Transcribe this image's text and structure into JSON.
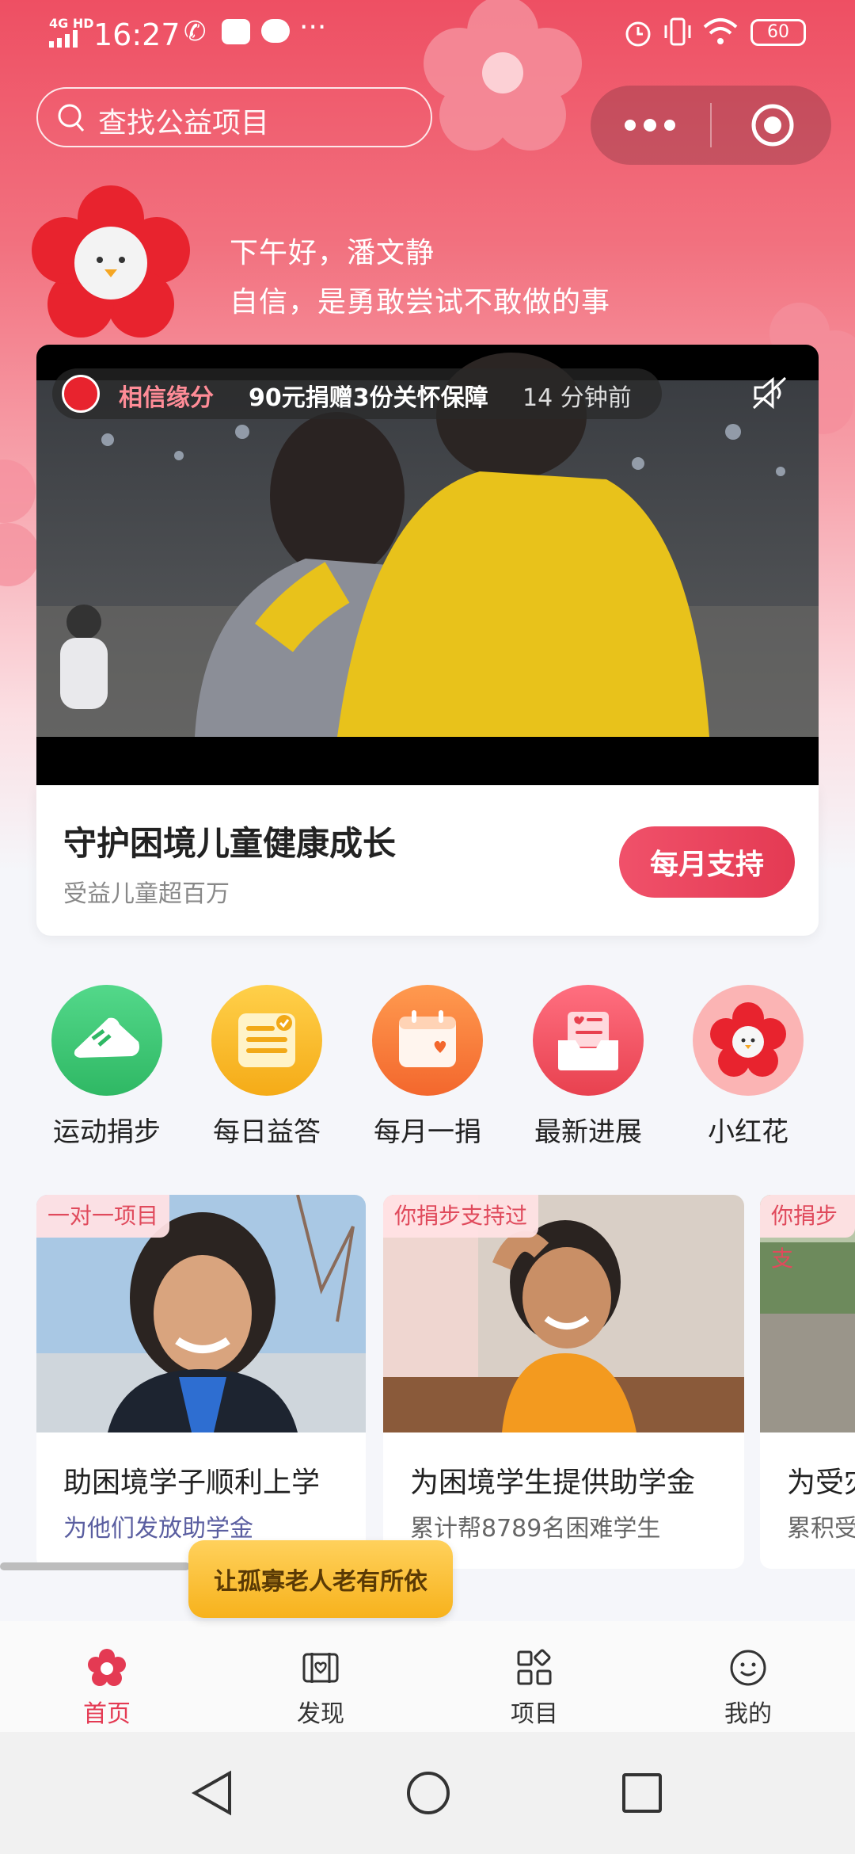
{
  "status_bar": {
    "network": "4G HD",
    "time": "16:27",
    "battery": "60"
  },
  "search": {
    "placeholder": "查找公益项目"
  },
  "greeting": {
    "line1": "下午好，潘文静",
    "line2": "自信，是勇敢尝试不敢做的事"
  },
  "banner": {
    "ticker_name": "相信缘分",
    "ticker_action": "90元捐赠3份关怀保障",
    "ticker_time": "14 分钟前",
    "title": "守护困境儿童健康成长",
    "subtitle": "受益儿童超百万",
    "button": "每月支持"
  },
  "shortcuts": [
    {
      "label": "运动捐步",
      "icon": "sneaker-icon",
      "color": "#3cc474"
    },
    {
      "label": "每日益答",
      "icon": "quiz-list-icon",
      "color": "#f7b422"
    },
    {
      "label": "每月一捐",
      "icon": "calendar-heart-icon",
      "color": "#f77a3a"
    },
    {
      "label": "最新进展",
      "icon": "inbox-update-icon",
      "color": "#ef5566"
    },
    {
      "label": "小红花",
      "icon": "red-flower-icon",
      "color": "#f9a5a5"
    }
  ],
  "projects": [
    {
      "tag": "一对一项目",
      "title": "助困境学子顺利上学",
      "subtitle": "为他们发放助学金"
    },
    {
      "tag": "你捐步支持过",
      "title": "为困境学生提供助学金",
      "subtitle": "累计帮8789名困难学生"
    },
    {
      "tag": "你捐步支",
      "title": "为受灾",
      "subtitle": "累积受"
    }
  ],
  "tooltip": "让孤寡老人老有所依",
  "tabs": [
    {
      "label": "首页",
      "icon": "flower-home-icon",
      "active": true
    },
    {
      "label": "发现",
      "icon": "discover-icon",
      "active": false
    },
    {
      "label": "项目",
      "icon": "grid-apps-icon",
      "active": false
    },
    {
      "label": "我的",
      "icon": "smiley-icon",
      "active": false
    }
  ],
  "colors": {
    "accent": "#e43a53",
    "tab_active": "#e43a53",
    "tab_inactive": "#333333"
  }
}
